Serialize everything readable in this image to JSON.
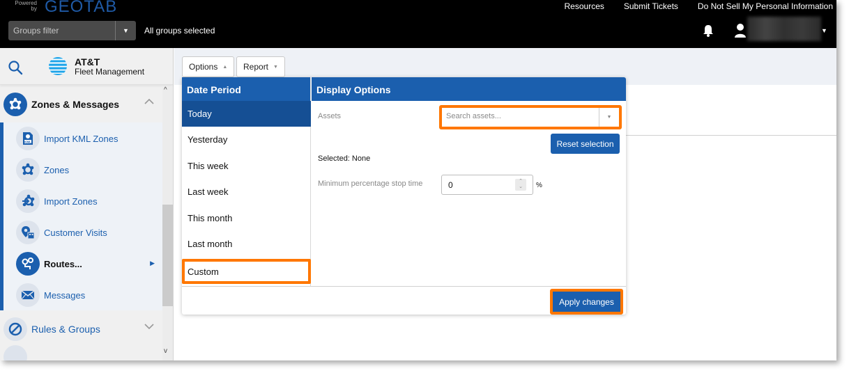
{
  "topbar": {
    "powered_by": "Powered by",
    "brand": "GEOTAB",
    "groups_filter_placeholder": "Groups filter",
    "groups_status": "All groups selected",
    "links": [
      "Resources",
      "Submit Tickets",
      "Do Not Sell My Personal Information"
    ],
    "icons": {
      "notifications": "bell-icon",
      "user": "user-icon",
      "user_menu": "caret-down-icon"
    }
  },
  "sidebar": {
    "logo_line1": "AT&T",
    "logo_line2": "Fleet Management",
    "groups": [
      {
        "label": "Zones & Messages",
        "icon": "zones-icon",
        "expanded": true
      },
      {
        "label": "Rules & Groups",
        "icon": "rules-icon",
        "expanded": false
      }
    ],
    "sub_items": [
      {
        "label": "Import KML Zones",
        "icon": "kml-file-icon"
      },
      {
        "label": "Zones",
        "icon": "zones-icon"
      },
      {
        "label": "Import Zones",
        "icon": "import-zones-icon"
      },
      {
        "label": "Customer Visits",
        "icon": "customer-visits-icon"
      },
      {
        "label": "Routes...",
        "icon": "routes-icon",
        "active": true
      },
      {
        "label": "Messages",
        "icon": "envelope-icon"
      }
    ]
  },
  "toolbar": {
    "options_label": "Options",
    "report_label": "Report"
  },
  "options_panel": {
    "date_period": {
      "heading": "Date Period",
      "items": [
        "Today",
        "Yesterday",
        "This week",
        "Last week",
        "This month",
        "Last month",
        "Custom"
      ],
      "selected": "Today",
      "highlighted": "Custom"
    },
    "display_options": {
      "heading": "Display Options",
      "assets_label": "Assets",
      "assets_placeholder": "Search assets...",
      "reset_label": "Reset selection",
      "selected_text": "Selected: None",
      "min_pct_label": "Minimum percentage stop time",
      "min_pct_value": "0",
      "min_pct_unit": "%"
    },
    "apply_label": "Apply changes"
  },
  "colors": {
    "brand_blue": "#1b5fae",
    "selected_blue": "#154f94",
    "highlight_orange": "#ff7700"
  }
}
